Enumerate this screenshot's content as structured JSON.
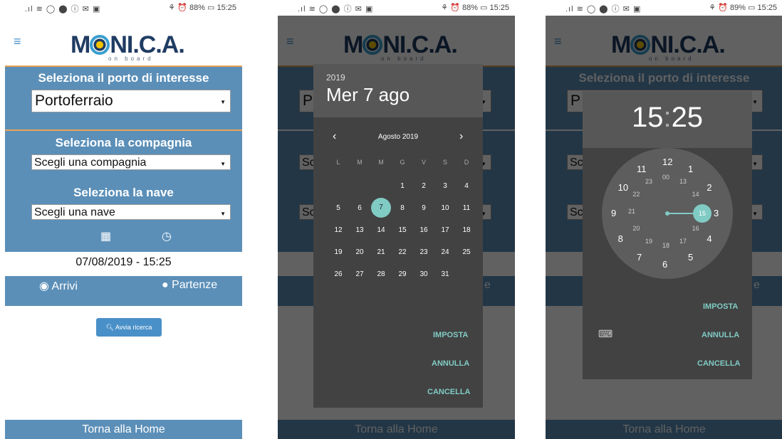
{
  "status": {
    "left": ".ıl ≋ ◯ ⬤ ⓘ ✉ ▣",
    "right_1": "⚘ ⏰ 88% ▭ 15:25",
    "right_3": "⚘ ⏰ 89% ▭ 15:25"
  },
  "app": {
    "menu_icon": "≡",
    "logo_text_pre": "M",
    "logo_text_post": "NI.C.A.",
    "logo_sub": "on board"
  },
  "form": {
    "port_label": "Seleziona il porto di interesse",
    "port_value": "Portoferraio",
    "company_label": "Seleziona la compagnia",
    "company_value": "Scegli una compagnia",
    "ship_label": "Seleziona la nave",
    "ship_value": "Scegli una nave",
    "calendar_icon": "▦",
    "clock_icon": "◷",
    "datetime": "07/08/2019 - 15:25",
    "arrivals_label": "Arrivi",
    "departures_label": "Partenze",
    "search_button": "Avvia ricerca",
    "home_label": "Torna alla Home"
  },
  "date_dialog": {
    "year": "2019",
    "date_title": "Mer 7 ago",
    "month": "Agosto 2019",
    "prev": "‹",
    "next": "›",
    "weekdays": [
      "L",
      "M",
      "M",
      "G",
      "V",
      "S",
      "D"
    ],
    "days": [
      "1",
      "2",
      "3",
      "4",
      "5",
      "6",
      "7",
      "8",
      "9",
      "10",
      "11",
      "12",
      "13",
      "14",
      "15",
      "16",
      "17",
      "18",
      "19",
      "20",
      "21",
      "22",
      "23",
      "24",
      "25",
      "26",
      "27",
      "28",
      "29",
      "30",
      "31"
    ],
    "selected_day": "7",
    "set_label": "IMPOSTA",
    "cancel_label": "ANNULLA",
    "clear_label": "CANCELLA"
  },
  "time_dialog": {
    "time_hour": "15",
    "time_sep": ":",
    "time_min": "25",
    "outer": [
      "12",
      "1",
      "2",
      "3",
      "4",
      "5",
      "6",
      "7",
      "8",
      "9",
      "10",
      "11"
    ],
    "inner": [
      "00",
      "13",
      "14",
      "15",
      "16",
      "17",
      "18",
      "19",
      "20",
      "21",
      "22",
      "23"
    ],
    "keyboard_icon": "⌨",
    "set_label": "IMPOSTA",
    "cancel_label": "ANNULLA",
    "clear_label": "CANCELLA"
  },
  "partial": {
    "p": "P",
    "sc": "Sc",
    "e": "e"
  }
}
